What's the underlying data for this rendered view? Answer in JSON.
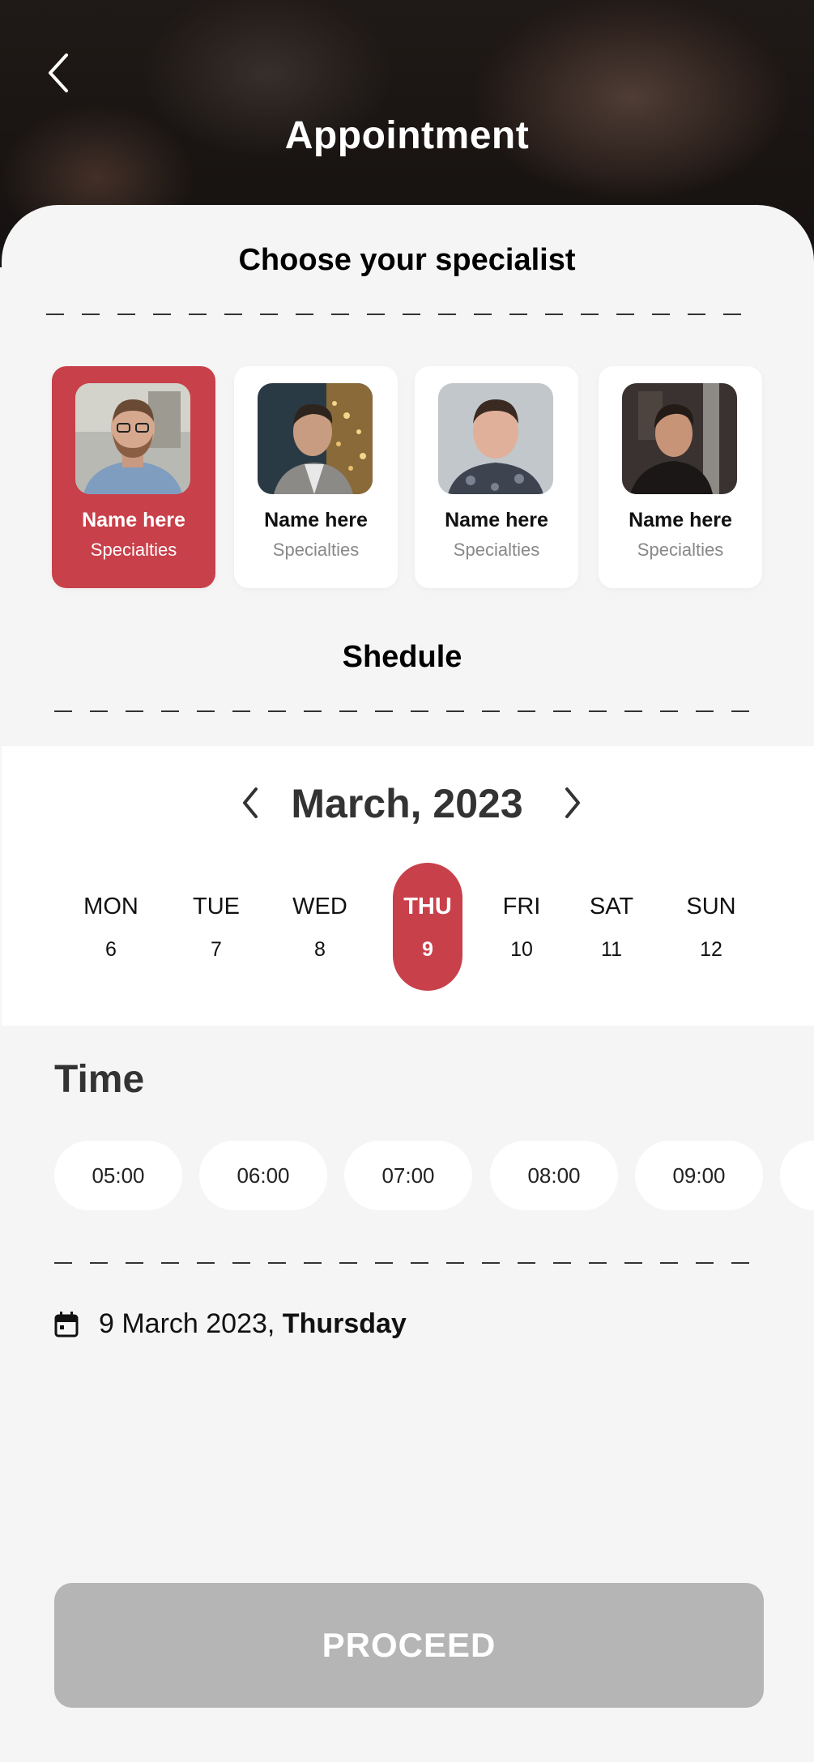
{
  "header": {
    "title": "Appointment"
  },
  "specialist_section": {
    "title": "Choose your specialist"
  },
  "specialists": [
    {
      "name": "Name here",
      "specialty": "Specialties",
      "selected": true
    },
    {
      "name": "Name here",
      "specialty": "Specialties",
      "selected": false
    },
    {
      "name": "Name here",
      "specialty": "Specialties",
      "selected": false
    },
    {
      "name": "Name here",
      "specialty": "Specialties",
      "selected": false
    }
  ],
  "schedule_section": {
    "title": "Shedule"
  },
  "calendar": {
    "month_label": "March, 2023",
    "days": [
      {
        "name": "MON",
        "date": "6"
      },
      {
        "name": "TUE",
        "date": "7"
      },
      {
        "name": "WED",
        "date": "8"
      },
      {
        "name": "THU",
        "date": "9",
        "selected": true
      },
      {
        "name": "FRI",
        "date": "10"
      },
      {
        "name": "SAT",
        "date": "11"
      },
      {
        "name": "SUN",
        "date": "12"
      }
    ]
  },
  "time_section": {
    "title": "Time"
  },
  "time_slots": [
    "05:00",
    "06:00",
    "07:00",
    "08:00",
    "09:00"
  ],
  "summary": {
    "date": "9 March 2023, ",
    "weekday": "Thursday"
  },
  "proceed_button": {
    "label": "PROCEED"
  },
  "colors": {
    "accent": "#c8404a",
    "disabled_button": "#b5b5b5",
    "background": "#f5f5f5"
  }
}
